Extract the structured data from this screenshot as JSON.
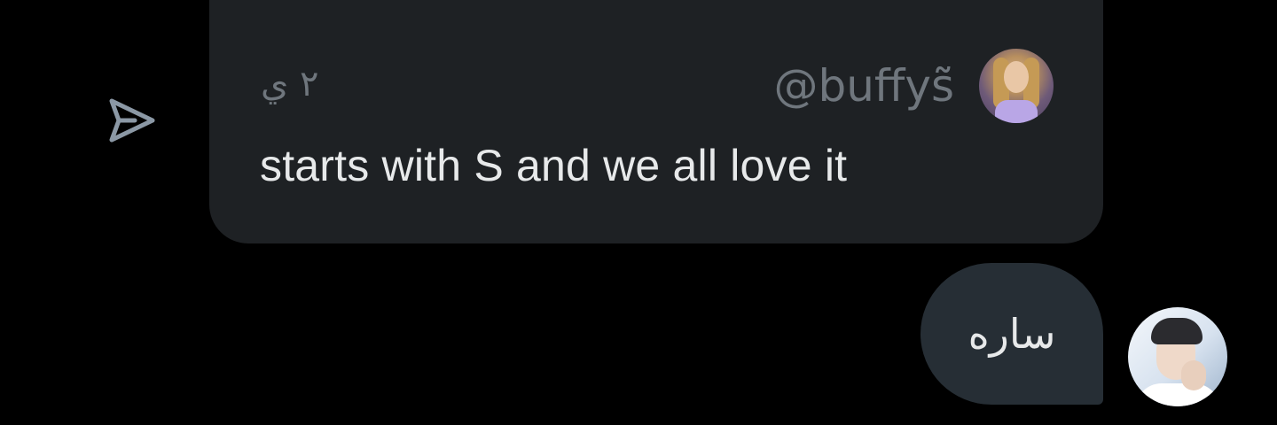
{
  "quoted_post": {
    "handle": "@buffys̃̃",
    "time": "٢ ي",
    "text": "starts with S and we all love it",
    "avatar_icon": "user-avatar-icon"
  },
  "reply": {
    "text": "ساره",
    "avatar_icon": "user-avatar-icon"
  },
  "actions": {
    "share_icon": "share-arrow-icon"
  },
  "colors": {
    "background": "#000000",
    "quoted_card": "#1e2124",
    "reply_bubble": "#262e35",
    "secondary_text": "#6f767d",
    "primary_text": "#e7e9ea",
    "share_icon": "#8b98a5"
  }
}
